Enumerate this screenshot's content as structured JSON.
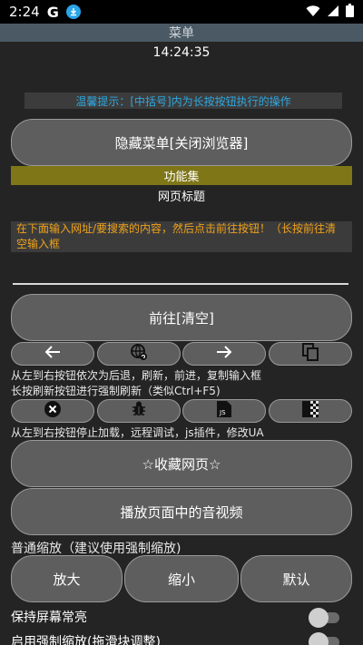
{
  "status_bar": {
    "time": "2:24",
    "g_label": "G"
  },
  "title_bar": {
    "title": "菜单"
  },
  "clock": "14:24:35",
  "tip": "温馨提示：[中括号]内为长按按钮执行的操作",
  "buttons": {
    "hide_menu": "隐藏菜单[关闭浏览器]",
    "go": "前往[清空]",
    "bookmark": "☆收藏网页☆",
    "play_media": "播放页面中的音视频",
    "zoom_in": "放大",
    "zoom_out": "缩小",
    "zoom_default": "默认"
  },
  "features_label": "功能集",
  "page_title_label": "网页标题",
  "input_hint": "在下面输入网址/要搜索的内容，然后点击前往按钮！（长按前往清空输入框",
  "nav_desc": {
    "line1": "从左到右按钮依次为后退，刷新，前进，复制输入框",
    "line2": "长按刷新按钮进行强制刷新（类似Ctrl+F5)"
  },
  "tools_desc": "从左到右按钮停止加载，远程调试，js插件，修改UA",
  "zoom_label": "普通缩放（建议使用强制缩放)",
  "toggles": {
    "keep_screen_on": "保持屏幕常亮",
    "force_zoom": "启用强制缩放(拖滑块调整)"
  },
  "icons": {
    "back": "arrow-left-icon",
    "refresh": "globe-refresh-icon",
    "forward": "arrow-right-icon",
    "copy": "copy-icon",
    "stop": "stop-icon",
    "debug": "bug-icon",
    "js": "js-file-icon",
    "ua": "checker-icon"
  },
  "colors": {
    "background": "#242424",
    "title_bar": "#4a5964",
    "tip_text": "#2fa8e0",
    "features_bar": "#7f7618",
    "warning_text": "#f0a21a",
    "button_fill": "#5e5e5e"
  }
}
